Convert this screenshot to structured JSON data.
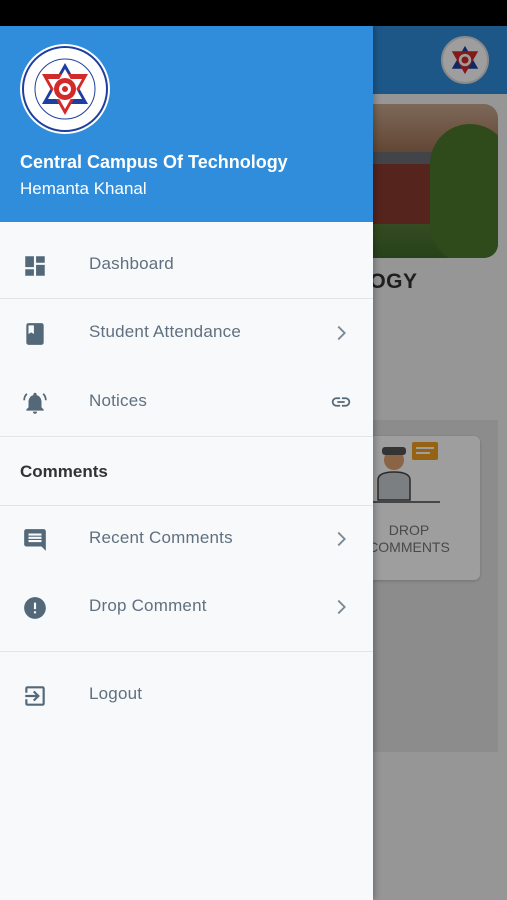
{
  "background": {
    "title_fragment": "LOGY",
    "card_label_line1": "DROP",
    "card_label_line2": "COMMENTS"
  },
  "drawer": {
    "org_name": "Central Campus Of Technology",
    "user_name": "Hemanta Khanal",
    "menu": [
      {
        "label": "Dashboard",
        "icon": "dashboard-icon"
      },
      {
        "label": "Student Attendance",
        "icon": "book-icon",
        "trailing": "chevron-right-icon"
      },
      {
        "label": "Notices",
        "icon": "bell-alert-icon",
        "trailing": "link-icon"
      }
    ],
    "comments_section": {
      "title": "Comments",
      "items": [
        {
          "label": "Recent Comments",
          "icon": "comment-icon",
          "trailing": "chevron-right-icon"
        },
        {
          "label": "Drop Comment",
          "icon": "alert-circle-icon",
          "trailing": "chevron-right-icon"
        }
      ]
    },
    "logout": {
      "label": "Logout",
      "icon": "logout-icon"
    }
  },
  "colors": {
    "primary": "#2f8ddb",
    "icon": "#536878",
    "drawer_bg": "#f8f9fa"
  }
}
